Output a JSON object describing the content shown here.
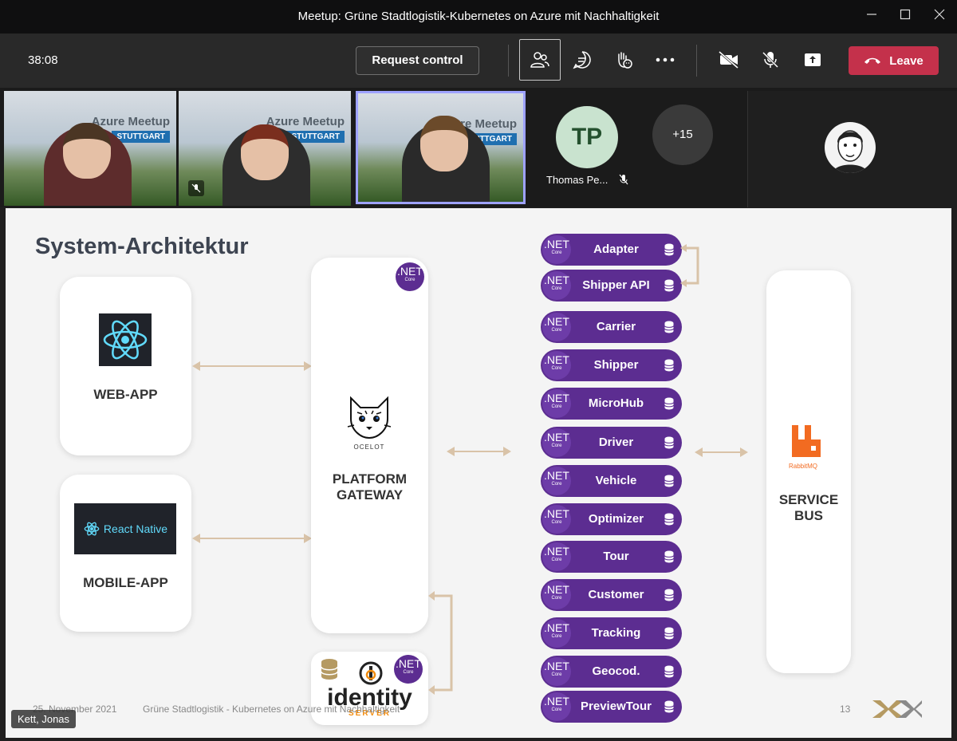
{
  "window": {
    "title": "Meetup: Grüne Stadtlogistik-Kubernetes on Azure mit Nachhaltigkeit",
    "minimize_icon": "minimize-icon",
    "maximize_icon": "maximize-icon",
    "close_icon": "close-icon"
  },
  "toolbar": {
    "timer": "38:08",
    "request_control_label": "Request control",
    "leave_label": "Leave",
    "leave_color": "#c4314b"
  },
  "participants": {
    "tile_brand_line1": "Azure Meetup",
    "tile_brand_line2": "STUTTGART",
    "tp_initials": "TP",
    "tp_name": "Thomas Pe...",
    "more_count": "+15",
    "speaker_name": "Kett, Jonas"
  },
  "slide": {
    "title": "System-Architektur",
    "web_app_label": "WEB-APP",
    "mobile_app_label": "MOBILE-APP",
    "react_native_label": "React Native",
    "gateway_label_1": "PLATFORM",
    "gateway_label_2": "GATEWAY",
    "ocelot_label": "OCELOT",
    "service_bus_1": "SERVICE",
    "service_bus_2": "BUS",
    "rabbitmq_label": "RabbitMQ",
    "identity_label": "identity",
    "identity_sub": "SERVER",
    "net_label": ".NET",
    "net_sub": "Core",
    "services": [
      "Adapter",
      "Shipper API",
      "Carrier",
      "Shipper",
      "MicroHub",
      "Driver",
      "Vehicle",
      "Optimizer",
      "Tour",
      "Customer",
      "Tracking",
      "Geocod.",
      "PreviewTour"
    ],
    "footer_date": "25. November 2021",
    "footer_text": "Grüne Stadtlogistik - Kubernetes on Azure mit Nachhaltigkeit",
    "page_number": "13"
  }
}
